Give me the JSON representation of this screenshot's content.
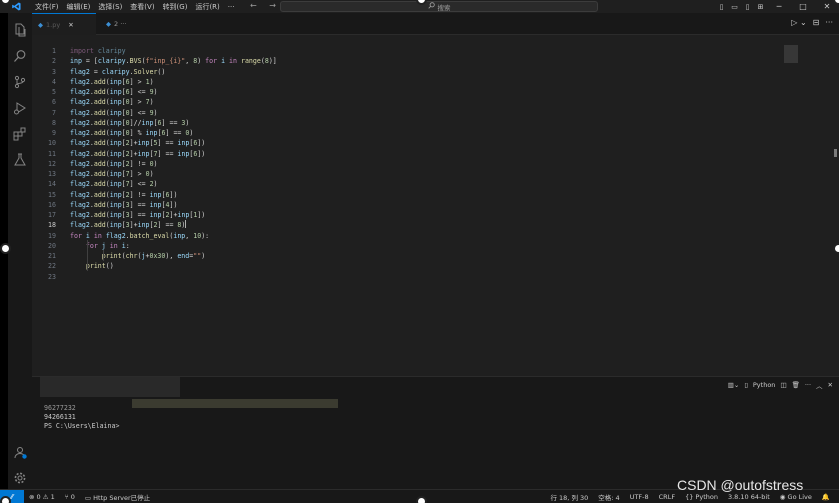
{
  "titlebar": {
    "menus": [
      "文件(F)",
      "编辑(E)",
      "选择(S)",
      "查看(V)",
      "转到(G)",
      "运行(R)",
      "···"
    ],
    "nav_arrows": "← →",
    "search_placeholder": "搜索"
  },
  "tabs": [
    {
      "label": "1.py",
      "active": true
    },
    {
      "label": "2 ···",
      "active": false
    }
  ],
  "editor": {
    "current_line": 18,
    "lines": [
      "import claripy",
      "inp = [claripy.BVS(f\"inp_{i}\", 8) for i in range(8)]",
      "flag2 = claripy.Solver()",
      "flag2.add(inp[6] > 1)",
      "flag2.add(inp[6] <= 9)",
      "flag2.add(inp[0] > 7)",
      "flag2.add(inp[0] <= 9)",
      "flag2.add(inp[0]//inp[6] == 3)",
      "flag2.add(inp[0] % inp[6] == 0)",
      "flag2.add(inp[2]+inp[5] == inp[6])",
      "flag2.add(inp[2]+inp[7] == inp[6])",
      "flag2.add(inp[2] != 0)",
      "flag2.add(inp[7] > 0)",
      "flag2.add(inp[7] <= 2)",
      "flag2.add(inp[2] != inp[6])",
      "flag2.add(inp[3] == inp[4])",
      "flag2.add(inp[3] == inp[2]+inp[1])",
      "flag2.add(inp[3]+inp[2] == 8)",
      "for i in flag2.batch_eval(inp, 10):",
      "    for j in i:",
      "        print(chr(j+0x30), end=\"\")",
      "    print()",
      ""
    ]
  },
  "panel": {
    "python_label": "Python",
    "terminal_lines": [
      "96277232",
      "94266131",
      "PS C:\\Users\\Elaina>"
    ]
  },
  "statusbar": {
    "errors": "0",
    "warnings": "1",
    "ports": "0",
    "http_server": "Http Server已停止",
    "position": "行 18, 列 30",
    "spaces": "空格: 4",
    "encoding": "UTF-8",
    "eol": "CRLF",
    "language": "Python",
    "interpreter": "3.8.10 64-bit",
    "golive": "Go Live"
  },
  "watermark": "CSDN @outofstress",
  "colors": {
    "accent": "#0078d4",
    "editor_bg": "#1f1f1f",
    "keyword": "#c586c0",
    "function": "#dcdcaa",
    "number": "#b5cea8",
    "string": "#ce9178"
  }
}
